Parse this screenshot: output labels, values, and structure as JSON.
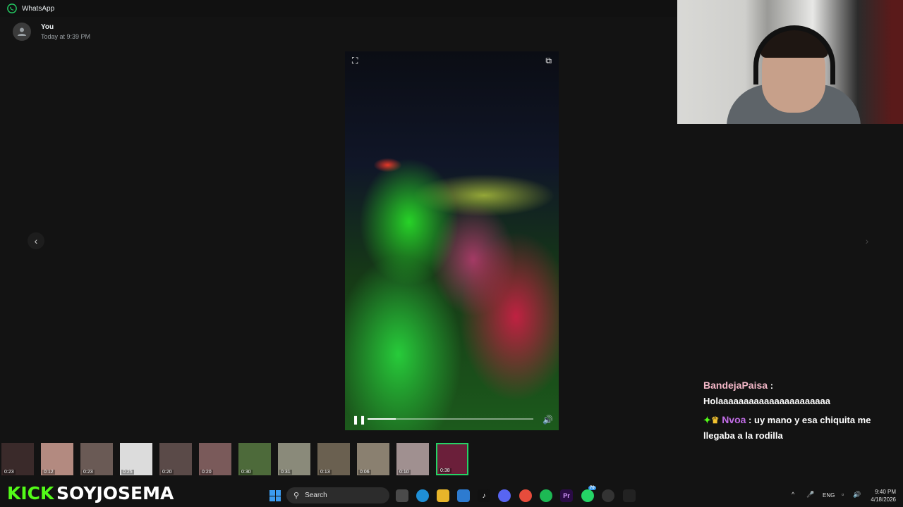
{
  "window": {
    "title": "WhatsApp"
  },
  "message": {
    "sender": "You",
    "time": "Today at 9:39 PM"
  },
  "player": {
    "progress": 0.17
  },
  "chat": [
    {
      "user": "BandejaPaisa",
      "separator": ":",
      "text": "Holaaaaaaaaaaaaaaaaaaaaaa"
    },
    {
      "user": "Nvoa",
      "separator": ":",
      "text": "uy mano y esa chiquita me llegaba a la rodilla"
    }
  ],
  "thumbnails": [
    {
      "duration": "0:23"
    },
    {
      "duration": "0:12"
    },
    {
      "duration": "0:23"
    },
    {
      "duration": "0:25"
    },
    {
      "duration": "0:20"
    },
    {
      "duration": "0:20"
    },
    {
      "duration": "0:30"
    },
    {
      "duration": "0:31"
    },
    {
      "duration": "0:13"
    },
    {
      "duration": "0:06"
    },
    {
      "duration": "0:10"
    },
    {
      "duration": "0:38"
    }
  ],
  "overlay": {
    "kick": "KICK",
    "channel": "SOYJOSEMA"
  },
  "taskbar": {
    "search_label": "Search",
    "whatsapp_badge": "70",
    "language": "ENG",
    "time": "9:40 PM",
    "date": "4/18/2026"
  }
}
